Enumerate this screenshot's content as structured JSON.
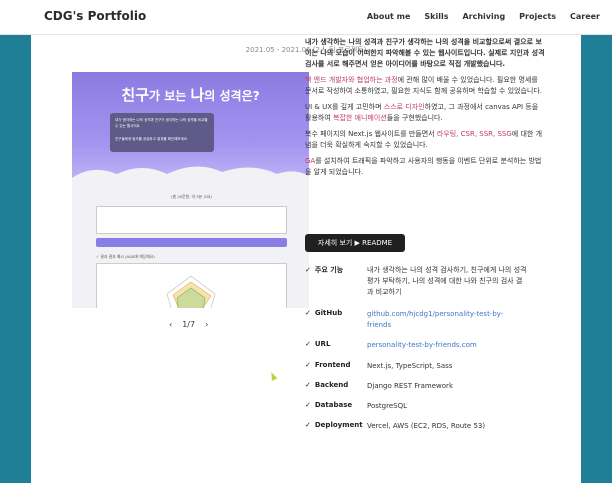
{
  "navbar": {
    "brand": "CDG's Portfolio",
    "items": [
      "About me",
      "Skills",
      "Archiving",
      "Projects",
      "Career"
    ]
  },
  "project": {
    "dateline": "2021.05 - 2021.06 (2人 팀 프로젝트)",
    "preview": {
      "title_a": "친구",
      "title_b": "가 보는 ",
      "title_c": "나",
      "title_d": "의 성격은?",
      "speech_1": "내가 생각하는 나의 성격과 친구가 생각하는 나의 성격을 비교할 수 있는 웹사이트",
      "speech_2": "친구들에게 링크를 공유하고 결과를 확인해보세요",
      "caption": "(총 20문항, 약 3분 소요)",
      "button": "테스트 하러 가기 >",
      "section": "✓ 결과 결과 예시 (A&B에 해당해요)"
    },
    "pager": {
      "prev": "‹",
      "label": "1/7",
      "next": "›"
    },
    "description": [
      {
        "parts": [
          {
            "t": "내가 생각하는 나의 성격과 친구가 생각하는 나의 성격을 비교할으로써 결으로 보이는 나의 모습이 어떠한지 파악해볼 수 있는 웹사이트입니다. 실제로 지인과 성격 검사를 서로 해주면서 얻은 아이디어를 바탕으로 직접 개발했습니다.",
            "s": "b"
          }
        ]
      },
      {
        "parts": [
          {
            "t": "백 엔드 개발자와 협업하는 과정",
            "s": "hl"
          },
          {
            "t": "에 관해 많이 배울 수 있었습니다. 필요한 명세를 문서로 작성하여 소통하였고, 필요한 지식도 함께 공유하며 학습할 수 있었습니다.",
            "s": ""
          }
        ]
      },
      {
        "parts": [
          {
            "t": "UI & UX를 깊게 고민하며 ",
            "s": ""
          },
          {
            "t": "스스로 디자인",
            "s": "hl"
          },
          {
            "t": "하였고, 그 과정에서 canvas API 등을 활용하여 ",
            "s": ""
          },
          {
            "t": "복잡한 애니메이션",
            "s": "hl"
          },
          {
            "t": "들을 구현했습니다.",
            "s": ""
          }
        ]
      },
      {
        "parts": [
          {
            "t": "복수 페이지의 Next.js 웹사이트를 만들면서 ",
            "s": ""
          },
          {
            "t": "라우팅, CSR, SSR, SSG",
            "s": "hl"
          },
          {
            "t": "에 대한 개념을 더욱 확실하게 숙지할 수 있었습니다.",
            "s": ""
          }
        ]
      },
      {
        "parts": [
          {
            "t": "GA",
            "s": "hl"
          },
          {
            "t": "를 설치하여 트래픽을 파악하고 사용자의 행동을 이벤트 단위로 분석하는 방법을 알게 되었습니다.",
            "s": ""
          }
        ]
      }
    ],
    "readme_button": "자세히 보기 ▶ README",
    "info": [
      {
        "key": "주요 기능",
        "value": "내가 생각하는 나의 성격 검사하기, 친구에게 나의 성격 평가 부탁하기, 나의 성격에 대한 나와 친구의 검사 결과 비교하기",
        "link": false
      },
      {
        "key": "GitHub",
        "value": "github.com/hjcdg1/personality-test-by-friends",
        "link": true
      },
      {
        "key": "URL",
        "value": "personality-test-by-friends.com",
        "link": true
      },
      {
        "key": "Frontend",
        "value": "Next.js, TypeScript, Sass",
        "link": false
      },
      {
        "key": "Backend",
        "value": "Django REST Framework",
        "link": false
      },
      {
        "key": "Database",
        "value": "PostgreSQL",
        "link": false
      },
      {
        "key": "Deployment",
        "value": "Vercel, AWS (EC2, RDS, Route 53)",
        "link": false
      }
    ],
    "check": "✓"
  },
  "colors": {
    "accent": "#c0396b",
    "link": "#3b78c4",
    "bg": "#2a8aa0",
    "preview_purple": "#8b7be0"
  }
}
